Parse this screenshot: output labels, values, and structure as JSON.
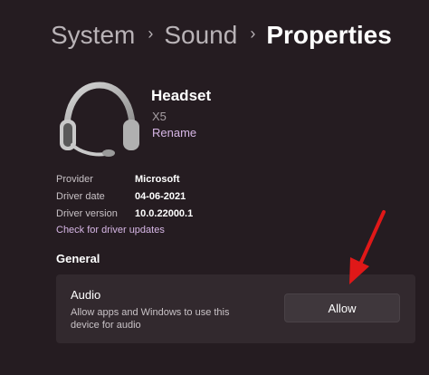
{
  "breadcrumb": {
    "items": [
      "System",
      "Sound"
    ],
    "current": "Properties",
    "separator": "›"
  },
  "device": {
    "name": "Headset",
    "model": "X5",
    "rename_label": "Rename",
    "icon": "headset-icon"
  },
  "properties": [
    {
      "label": "Provider",
      "value": "Microsoft"
    },
    {
      "label": "Driver date",
      "value": "04-06-2021"
    },
    {
      "label": "Driver version",
      "value": "10.0.22000.1"
    }
  ],
  "check_updates_label": "Check for driver updates",
  "general": {
    "title": "General",
    "audio": {
      "title": "Audio",
      "description": "Allow apps and Windows to use this device for audio",
      "button_label": "Allow"
    }
  },
  "colors": {
    "background": "#251c21",
    "card": "#32292e",
    "link": "#d6b6e5",
    "annotation_arrow": "#e01818"
  }
}
